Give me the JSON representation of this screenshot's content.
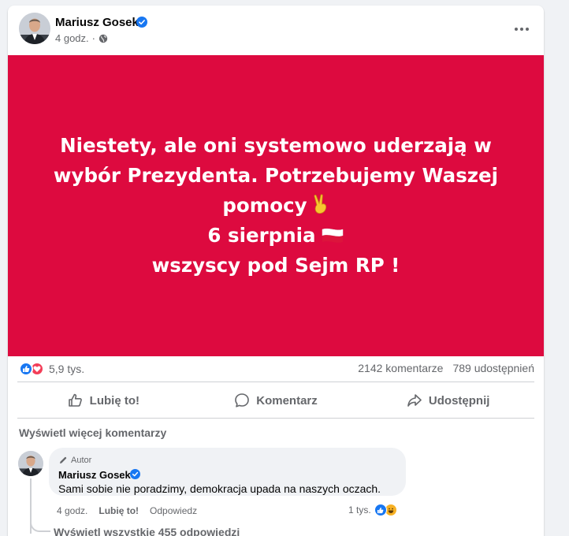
{
  "post": {
    "author": "Mariusz Gosek",
    "time": "4 godz.",
    "meta_separator": "·",
    "privacy_icon": "globe-icon",
    "more_icon": "more-horizontal-icon"
  },
  "banner": {
    "background": "#dd0a3f",
    "lines": [
      "Niestety, ale oni systemowo uderzają w",
      "wybór Prezydenta. Potrzebujemy Waszej",
      "pomocy",
      "6 sierpnia",
      "wszyscy pod Sejm RP !"
    ],
    "emoji_victory": "victory-hand-icon",
    "emoji_flag": "poland-flag-icon"
  },
  "stats": {
    "reactions_count": "5,9 tys.",
    "comments": "2142 komentarze",
    "shares": "789 udostępnień"
  },
  "actions": {
    "like": "Lubię to!",
    "comment": "Komentarz",
    "share": "Udostępnij"
  },
  "comments": {
    "view_more": "Wyświetl więcej komentarzy",
    "view_all_replies": "Wyświetl wszystkie 455 odpowiedzi",
    "items": [
      {
        "badge": "Autor",
        "author": "Mariusz Gosek",
        "text": "Sami sobie nie poradzimy, demokracja upada na naszych oczach.",
        "time": "4 godz.",
        "like": "Lubię to!",
        "reply": "Odpowiedz",
        "reactions_count": "1 tys."
      }
    ]
  },
  "colors": {
    "brand_blue": "#1877f2",
    "love_red": "#f33e58",
    "secondary_text": "#65676b"
  }
}
